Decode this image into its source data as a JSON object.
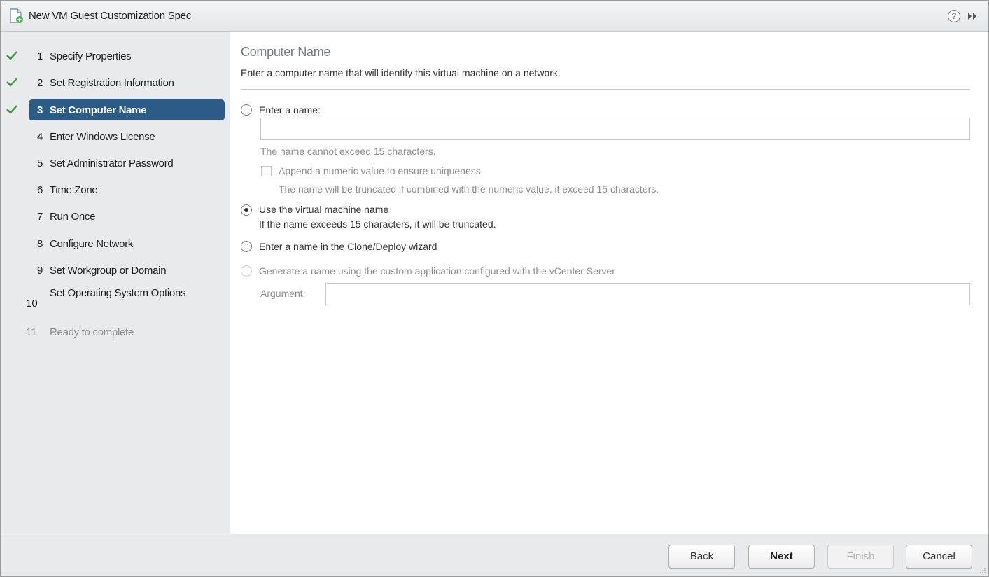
{
  "title": "New VM Guest Customization Spec",
  "icons": {
    "title": "document-add-icon",
    "help": "help-icon",
    "expand": "double-chevron-right-icon",
    "check": "checkmark-icon"
  },
  "help_glyph": "?",
  "colors": {
    "accent": "#2b5b87",
    "check": "#3a9a3a"
  },
  "steps": [
    {
      "num": "1",
      "label": "Specify Properties",
      "state": "done"
    },
    {
      "num": "2",
      "label": "Set Registration Information",
      "state": "done"
    },
    {
      "num": "3",
      "label": "Set Computer Name",
      "state": "current"
    },
    {
      "num": "4",
      "label": "Enter Windows License",
      "state": "pending"
    },
    {
      "num": "5",
      "label": "Set Administrator Password",
      "state": "pending"
    },
    {
      "num": "6",
      "label": "Time Zone",
      "state": "pending"
    },
    {
      "num": "7",
      "label": "Run Once",
      "state": "pending"
    },
    {
      "num": "8",
      "label": "Configure Network",
      "state": "pending"
    },
    {
      "num": "9",
      "label": "Set Workgroup or Domain",
      "state": "pending"
    },
    {
      "num": "10",
      "label": "Set Operating System Options",
      "state": "pending"
    },
    {
      "num": "11",
      "label": "Ready to complete",
      "state": "disabled"
    }
  ],
  "page": {
    "heading": "Computer Name",
    "description": "Enter a computer name that will identify this virtual machine on a network.",
    "options": {
      "enter_name": {
        "label": "Enter a name:",
        "value": "",
        "hint": "The name cannot exceed 15 characters.",
        "append_label": "Append a numeric value to ensure uniqueness",
        "append_hint": "The name will be truncated if combined with the numeric value, it exceed 15 characters.",
        "checked": false
      },
      "use_vm_name": {
        "label": "Use the virtual machine name",
        "hint": "If the name exceeds 15 characters, it will be truncated.",
        "checked": true
      },
      "clone_wizard": {
        "label": "Enter a name in the Clone/Deploy wizard",
        "checked": false
      },
      "custom_app": {
        "label": "Generate a name using the custom application configured with the vCenter Server",
        "argument_label": "Argument:",
        "argument_value": "",
        "checked": false,
        "disabled": true
      }
    }
  },
  "footer": {
    "back": "Back",
    "next": "Next",
    "finish": "Finish",
    "cancel": "Cancel"
  }
}
